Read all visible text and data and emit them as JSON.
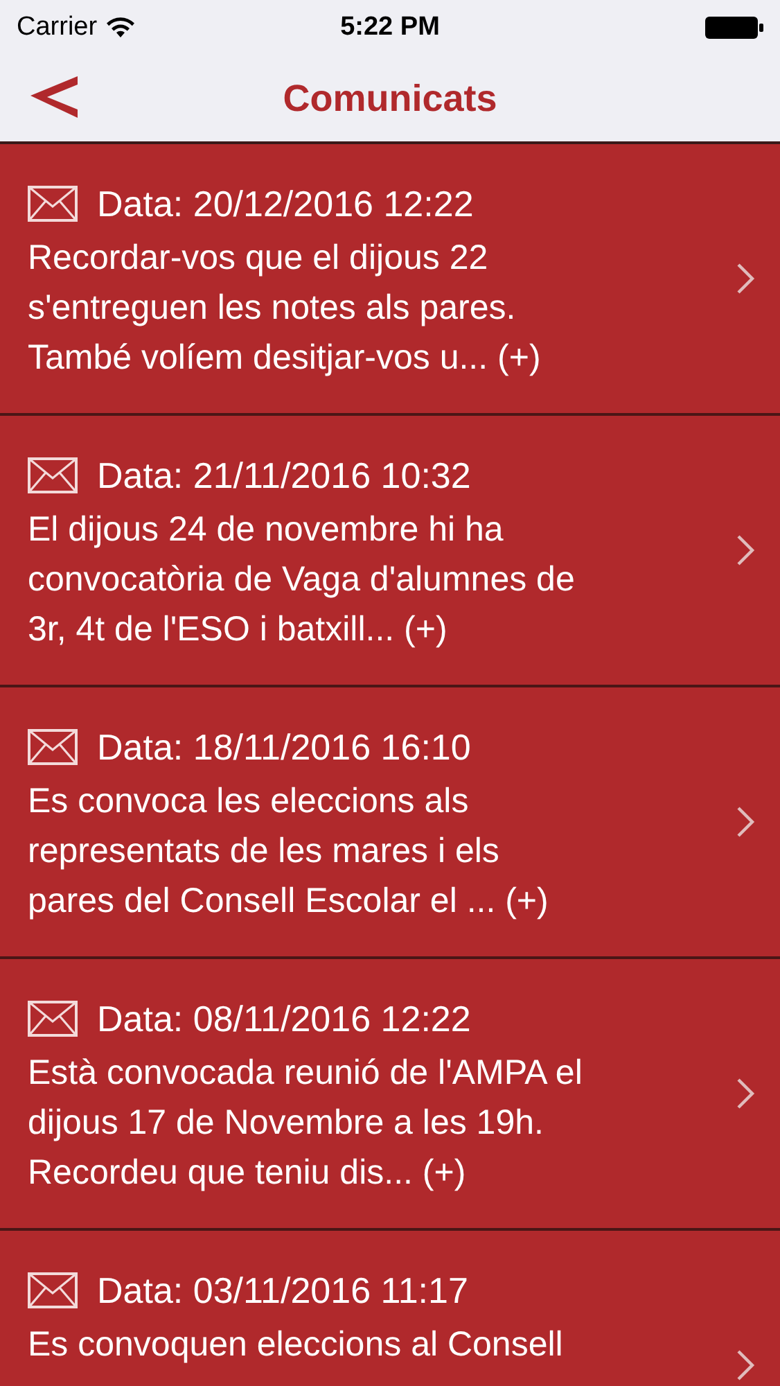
{
  "status_bar": {
    "carrier": "Carrier",
    "time": "5:22 PM"
  },
  "nav": {
    "title": "Comunicats"
  },
  "messages": [
    {
      "date": "Data: 20/12/2016 12:22",
      "lines": [
        "Recordar-vos que el dijous 22",
        "s'entreguen les notes als pares.",
        "També volíem desitjar-vos u... (+)"
      ]
    },
    {
      "date": "Data: 21/11/2016 10:32",
      "lines": [
        "El dijous 24 de novembre hi ha",
        "convocatòria de Vaga d'alumnes de",
        "3r, 4t de l'ESO i batxill... (+)"
      ]
    },
    {
      "date": "Data: 18/11/2016 16:10",
      "lines": [
        "Es convoca les eleccions als",
        "representats de les mares i els",
        "pares del Consell Escolar el ... (+)"
      ]
    },
    {
      "date": "Data: 08/11/2016 12:22",
      "lines": [
        "Està convocada reunió de l'AMPA el",
        "dijous 17 de Novembre a les 19h.",
        "Recordeu que teniu dis... (+)"
      ]
    },
    {
      "date": "Data: 03/11/2016 11:17",
      "lines": [
        "Es convoquen eleccions al Consell"
      ]
    }
  ]
}
